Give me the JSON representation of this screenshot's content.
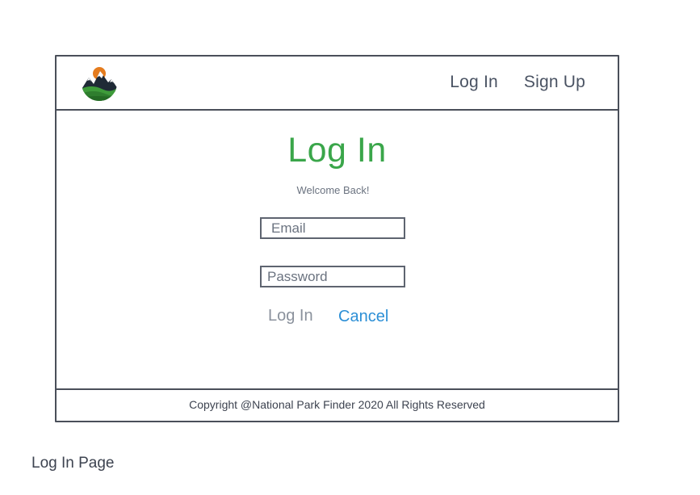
{
  "header": {
    "logo_icon": "mountain-logo-icon",
    "nav": {
      "login_label": "Log In",
      "signup_label": "Sign Up"
    }
  },
  "main": {
    "title": "Log In",
    "subtitle": "Welcome Back!",
    "email_placeholder": "Email",
    "password_placeholder": "Password",
    "login_button": "Log In",
    "cancel_button": "Cancel"
  },
  "footer": {
    "copyright": "Copyright @National Park Finder 2020 All Rights Reserved"
  },
  "caption": "Log In Page",
  "colors": {
    "accent_green": "#3aa64a",
    "link_blue": "#2c8fd6",
    "frame_border": "#4a4f5a",
    "text_gray": "#4a5363"
  }
}
